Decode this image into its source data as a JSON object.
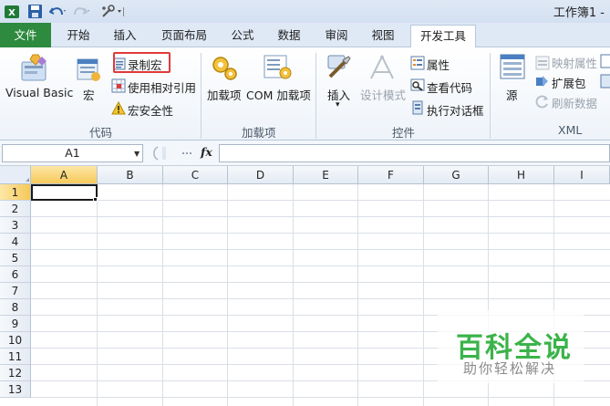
{
  "window": {
    "title": "工作簿1 -"
  },
  "quick_access": [
    "excel-logo-icon",
    "save-icon",
    "undo-icon",
    "redo-icon",
    "customize-icon"
  ],
  "tabs": [
    "文件",
    "开始",
    "插入",
    "页面布局",
    "公式",
    "数据",
    "审阅",
    "视图",
    "开发工具"
  ],
  "active_tab": "开发工具",
  "ribbon": {
    "code": {
      "label": "代码",
      "visual_basic": "Visual Basic",
      "macros": "宏",
      "record_macro": "录制宏",
      "relative_refs": "使用相对引用",
      "macro_security": "宏安全性"
    },
    "addins": {
      "label": "加载项",
      "addins": "加载项",
      "com_addins": "COM 加载项"
    },
    "controls": {
      "label": "控件",
      "insert": "插入",
      "design_mode": "设计模式",
      "properties": "属性",
      "view_code": "查看代码",
      "run_dialog": "执行对话框"
    },
    "xml": {
      "label": "XML",
      "source": "源",
      "map_props": "映射属性",
      "expansion_packs": "扩展包",
      "refresh_data": "刷新数据"
    }
  },
  "formula_bar": {
    "name_box": "A1",
    "fx": "fx",
    "formula": ""
  },
  "sheet": {
    "columns": [
      "A",
      "B",
      "C",
      "D",
      "E",
      "F",
      "G",
      "H",
      "I"
    ],
    "rows": [
      "1",
      "2",
      "3",
      "4",
      "5",
      "6",
      "7",
      "8",
      "9",
      "10",
      "11",
      "12",
      "13"
    ],
    "active_cell": "A1"
  },
  "watermark": {
    "title": "百科全说",
    "subtitle": "助你轻松解决"
  },
  "colors": {
    "file_tab": "#2d8a3e",
    "highlight": "#e03a3a",
    "selected_header": "#f6c95a",
    "watermark": "#3bb34a"
  }
}
